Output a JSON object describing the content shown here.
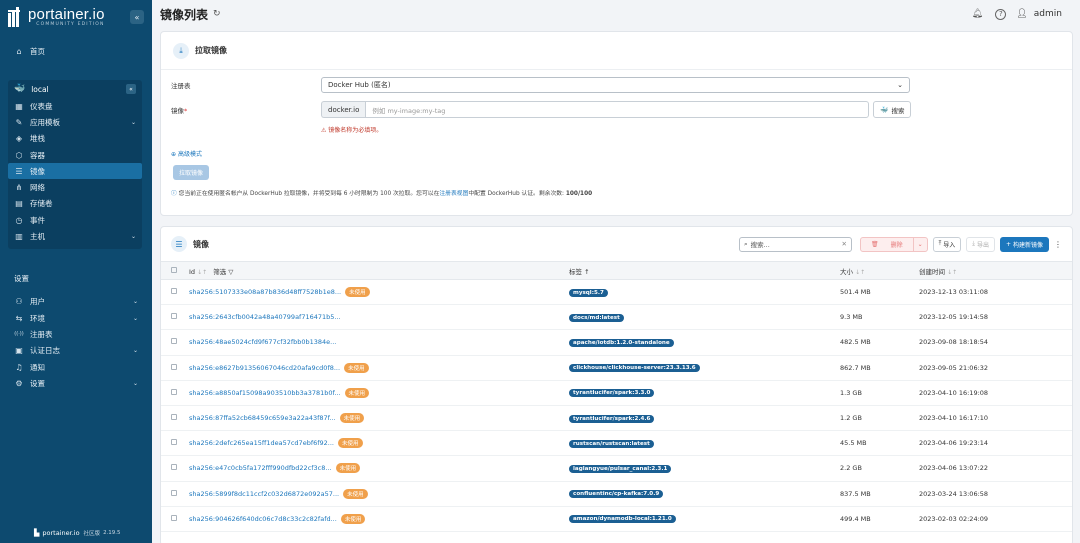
{
  "app": {
    "logo_main": "portainer.io",
    "logo_sub": "COMMUNITY EDITION",
    "footer_name": "portainer.io",
    "footer_edition": "社区版",
    "footer_version": "2.19.5"
  },
  "sidebar": {
    "home": "首页",
    "env_name": "local",
    "env_items": [
      {
        "label": "仪表盘",
        "icon": "dashboard-icon",
        "chevron": false
      },
      {
        "label": "应用模板",
        "icon": "templates-icon",
        "chevron": true
      },
      {
        "label": "堆栈",
        "icon": "stacks-icon",
        "chevron": false
      },
      {
        "label": "容器",
        "icon": "containers-icon",
        "chevron": false
      },
      {
        "label": "镜像",
        "icon": "images-icon",
        "chevron": false,
        "active": true
      },
      {
        "label": "网络",
        "icon": "networks-icon",
        "chevron": false
      },
      {
        "label": "存储卷",
        "icon": "volumes-icon",
        "chevron": false
      },
      {
        "label": "事件",
        "icon": "events-icon",
        "chevron": false
      },
      {
        "label": "主机",
        "icon": "host-icon",
        "chevron": true
      }
    ],
    "settings_title": "设置",
    "settings_items": [
      {
        "label": "用户",
        "icon": "users-icon",
        "chevron": true
      },
      {
        "label": "环境",
        "icon": "environments-icon",
        "chevron": true
      },
      {
        "label": "注册表",
        "icon": "registries-icon",
        "chevron": false
      },
      {
        "label": "认证日志",
        "icon": "auth-logs-icon",
        "chevron": true
      },
      {
        "label": "通知",
        "icon": "notifications-icon",
        "chevron": false
      },
      {
        "label": "设置",
        "icon": "settings-icon",
        "chevron": true
      }
    ]
  },
  "topbar": {
    "title": "镜像列表",
    "user": "admin"
  },
  "pull": {
    "title": "拉取镜像",
    "registry_label": "注册表",
    "registry_value": "Docker Hub (匿名)",
    "image_label": "镜像",
    "image_required": "*",
    "prefix": "docker.io",
    "image_placeholder": "例如 my-image:my-tag",
    "search_label": "搜索",
    "warning": "镜像名称为必填项。",
    "advanced": "高级模式",
    "pull_button": "拉取镜像",
    "info_prefix": "您当前正在使用匿名帐户从 DockerHub 拉取镜像，并将受到每 6 小时限制为 100 次拉取。您可以在",
    "info_link": "注册表视图",
    "info_suffix": "中配置 DockerHub 认证。剩余次数:",
    "info_count": "100/100"
  },
  "images": {
    "title": "镜像",
    "search_placeholder": "搜索...",
    "delete_label": "删除",
    "import_label": "导入",
    "export_label": "导出",
    "build_label": "构建新镜像",
    "col_id": "Id",
    "col_filter": "筛选",
    "col_tag": "标签",
    "col_size": "大小",
    "col_created": "创建时间",
    "unused_label": "未使用",
    "rows": [
      {
        "id": "sha256:5107333e08a87b836d48ff7528b1e8...",
        "unused": true,
        "tag": "mysql:5.7",
        "size": "501.4 MB",
        "created": "2023-12-13 03:11:08"
      },
      {
        "id": "sha256:2643cfb0042a48a40799af716471b5...",
        "unused": false,
        "tag": "docs/md:latest",
        "size": "9.3 MB",
        "created": "2023-12-05 19:14:58"
      },
      {
        "id": "sha256:48ae5024cfd9f677cf32fbb0b1384e...",
        "unused": false,
        "tag": "apache/iotdb:1.2.0-standalone",
        "size": "482.5 MB",
        "created": "2023-09-08 18:18:54"
      },
      {
        "id": "sha256:e8627b91356067046cd20afa9cd0f8...",
        "unused": true,
        "tag": "clickhouse/clickhouse-server:23.3.13.6",
        "size": "862.7 MB",
        "created": "2023-09-05 21:06:32"
      },
      {
        "id": "sha256:a8850af15098a903510bb3a3781b0f...",
        "unused": true,
        "tag": "tyrantlucifer/spark:3.3.0",
        "size": "1.3 GB",
        "created": "2023-04-10 16:19:08"
      },
      {
        "id": "sha256:87ffa52cb68459c659e3a22a43f87f...",
        "unused": true,
        "tag": "tyrantlucifer/spark:2.4.6",
        "size": "1.2 GB",
        "created": "2023-04-10 16:17:10"
      },
      {
        "id": "sha256:2defc265ea15ff1dea57cd7ebf6f92...",
        "unused": true,
        "tag": "rustscan/rustscan:latest",
        "size": "45.5 MB",
        "created": "2023-04-06 19:23:14"
      },
      {
        "id": "sha256:e47c0cb5fa172fff990dfbd22cf3c8...",
        "unused": true,
        "tag": "laglangyue/pulsar_canal:2.3.1",
        "size": "2.2 GB",
        "created": "2023-04-06 13:07:22"
      },
      {
        "id": "sha256:5899f8dc11ccf2c032d6872e092a57...",
        "unused": true,
        "tag": "confluentinc/cp-kafka:7.0.9",
        "size": "837.5 MB",
        "created": "2023-03-24 13:06:58"
      },
      {
        "id": "sha256:904626f640dc06c7d8c33c2c82fafd...",
        "unused": true,
        "tag": "amazon/dynamodb-local:1.21.0",
        "size": "499.4 MB",
        "created": "2023-02-03 02:24:09"
      }
    ]
  },
  "colors": {
    "sidebar_bg": "#0d4a6f",
    "accent": "#1c77bd",
    "unused_badge": "#f0a04b",
    "tag_badge": "#1b5f93"
  }
}
